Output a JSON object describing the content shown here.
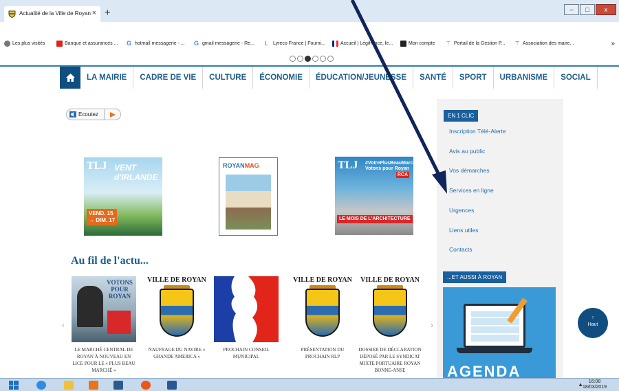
{
  "browser": {
    "tab_title": "Actualité de la Ville de Royan",
    "tab_close": "×",
    "new_tab": "+",
    "win_min": "–",
    "win_max": "□",
    "win_close": "x",
    "bookmarks": [
      {
        "label": "Les plus visités",
        "color": "#555555"
      },
      {
        "label": "Banque et assurances ...",
        "color": "#e2231a"
      },
      {
        "label": "hotmail messagerie - ...",
        "color": "#4285f4"
      },
      {
        "label": "gmail messagerie - Re...",
        "color": "#4285f4"
      },
      {
        "label": "Lyreco France | Fourni...",
        "color": "#1d5e8c"
      },
      {
        "label": "Accueil | Légifrance, le...",
        "color": "#c8102e"
      },
      {
        "label": "Mon compte",
        "color": "#222222"
      },
      {
        "label": "Portail de la Gestion P...",
        "color": "#888888"
      },
      {
        "label": "Association des maire...",
        "color": "#1d5e8c"
      }
    ],
    "bookmarks_more": "»"
  },
  "nav": {
    "home_icon": "home-icon",
    "items": [
      "LA MAIRIE",
      "CADRE DE VIE",
      "CULTURE",
      "ÉCONOMIE",
      "ÉDUCATION/JEUNESSE",
      "SANTÉ",
      "SPORT",
      "URBANISME",
      "SOCIAL"
    ]
  },
  "listen": {
    "label": "Ecoutez",
    "icon": "speaker-icon"
  },
  "magazines": [
    {
      "brand": "TLJ",
      "title": "VENT d'IRLANDE",
      "date": "VEND. 15\n→ DIM. 17"
    },
    {
      "brand": "ROYAN",
      "brand2": "MAG"
    },
    {
      "brand": "TLJ",
      "title": "#VotrePlusBeauMarchéDeFrance Votons pour Royan",
      "badge": "RCA",
      "banner": "LE MOIS DE L'ARCHITECTURE"
    }
  ],
  "section_title": "Au fil de l'actu...",
  "news": [
    {
      "top": "VOTONS POUR ROYAN",
      "caption": "LE MARCHÉ CENTRAL DE ROYAN À NOUVEAU EN LICE POUR LE « PLUS BEAU MARCHÉ »"
    },
    {
      "top": "VILLE DE ROYAN",
      "caption": "NAUFRAGE DU NAVIRE « GRANDE AMERICA »"
    },
    {
      "top": "",
      "caption": "PROCHAIN CONSEIL MUNICIPAL"
    },
    {
      "top": "VILLE DE ROYAN",
      "caption": "PRÉSENTATION DU PROCHAIN RLP"
    },
    {
      "top": "VILLE DE ROYAN",
      "caption": "DOSSIER DE DÉCLARATION DÉPOSÉ PAR LE SYNDICAT MIXTE PORTUAIRE ROYAN BONNE-ANSE"
    }
  ],
  "carousel": {
    "prev": "‹",
    "next": "›",
    "dots": 6,
    "active": 3
  },
  "sidebar": {
    "header1": "EN 1 CLIC",
    "links": [
      "Inscription Télé-Alerte",
      "Avis au public",
      "Vos démarches",
      "Services en ligne",
      "Urgences",
      "Liens utiles",
      "Contacts"
    ],
    "header2": "...ET AUSSI À ROYAN",
    "promo_word": "AGENDA"
  },
  "haut": {
    "label": "Haut",
    "arrow": "↑"
  },
  "taskbar": {
    "time": "16:08",
    "date": "18/03/2019",
    "tray": "▲"
  },
  "colors": {
    "brand_blue": "#0f4e7e",
    "nav_text": "#1d5e8c",
    "link": "#1d6cb0",
    "pointer": "#10255a"
  }
}
